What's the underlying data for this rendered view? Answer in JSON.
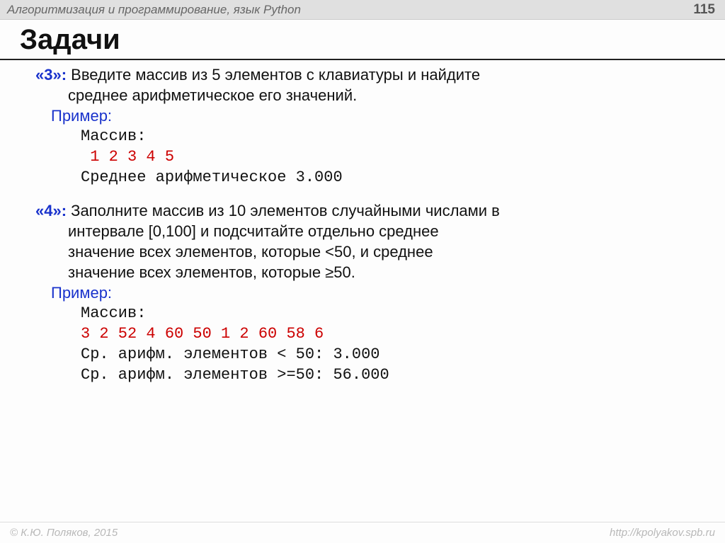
{
  "header": {
    "title": "Алгоритмизация и программирование, язык Python",
    "page": "115"
  },
  "slide_title": "Задачи",
  "task3": {
    "label": "«3»:",
    "text_l1": " Введите массив из 5 элементов с клавиатуры и найдите",
    "text_l2": "среднее арифметическое его значений.",
    "example_label": "Пример:",
    "mono_l1": "Массив:",
    "mono_l2": " 1 2 3 4 5",
    "mono_l3": "Среднее арифметическое 3.000"
  },
  "task4": {
    "label": "«4»:",
    "text_l1": " Заполните массив из 10 элементов случайными числами в",
    "text_l2": "интервале [0,100] и подсчитайте отдельно среднее",
    "text_l3": "значение всех элементов, которые <50, и среднее",
    "text_l4": "значение всех элементов, которые ≥50.",
    "example_label": "Пример:",
    "mono_l1": "Массив:",
    "mono_l2": "3 2 52 4 60 50 1 2 60 58 6",
    "mono_l3": "Ср. арифм. элементов < 50: 3.000",
    "mono_l4": "Ср. арифм. элементов >=50: 56.000"
  },
  "footer": {
    "left": "© К.Ю. Поляков, 2015",
    "right": "http://kpolyakov.spb.ru"
  }
}
